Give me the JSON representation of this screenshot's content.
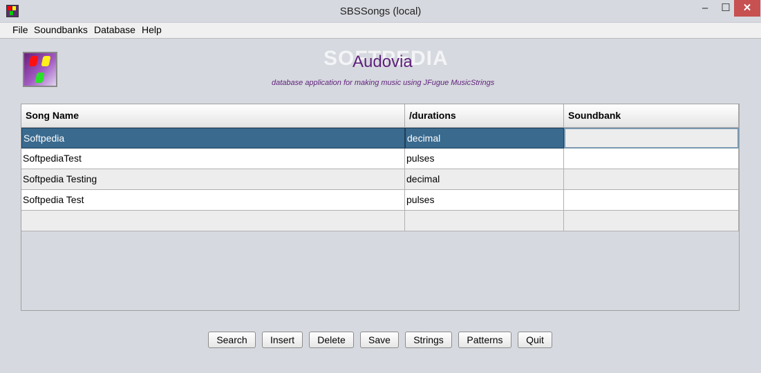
{
  "window": {
    "title": "SBSSongs (local)",
    "controls": {
      "minimize": "–",
      "maximize": "☐",
      "close": "✕"
    }
  },
  "menu": [
    "File",
    "Soundbanks",
    "Database",
    "Help"
  ],
  "header": {
    "watermark": "SOFTPEDIA",
    "app_name": "Audovia",
    "tagline": "database application for making music using JFugue MusicStrings"
  },
  "table": {
    "columns": [
      "Song Name",
      "/durations",
      "Soundbank"
    ],
    "rows": [
      {
        "song": "Softpedia",
        "durations": "decimal",
        "soundbank": ""
      },
      {
        "song": "SoftpediaTest",
        "durations": "pulses",
        "soundbank": ""
      },
      {
        "song": "Softpedia Testing",
        "durations": "decimal",
        "soundbank": ""
      },
      {
        "song": "Softpedia Test",
        "durations": "pulses",
        "soundbank": ""
      },
      {
        "song": "",
        "durations": "",
        "soundbank": ""
      }
    ]
  },
  "buttons": [
    "Search",
    "Insert",
    "Delete",
    "Save",
    "Strings",
    "Patterns",
    "Quit"
  ],
  "colors": {
    "selection": "#3a6a8e",
    "brand_purple": "#5e1f7a"
  }
}
